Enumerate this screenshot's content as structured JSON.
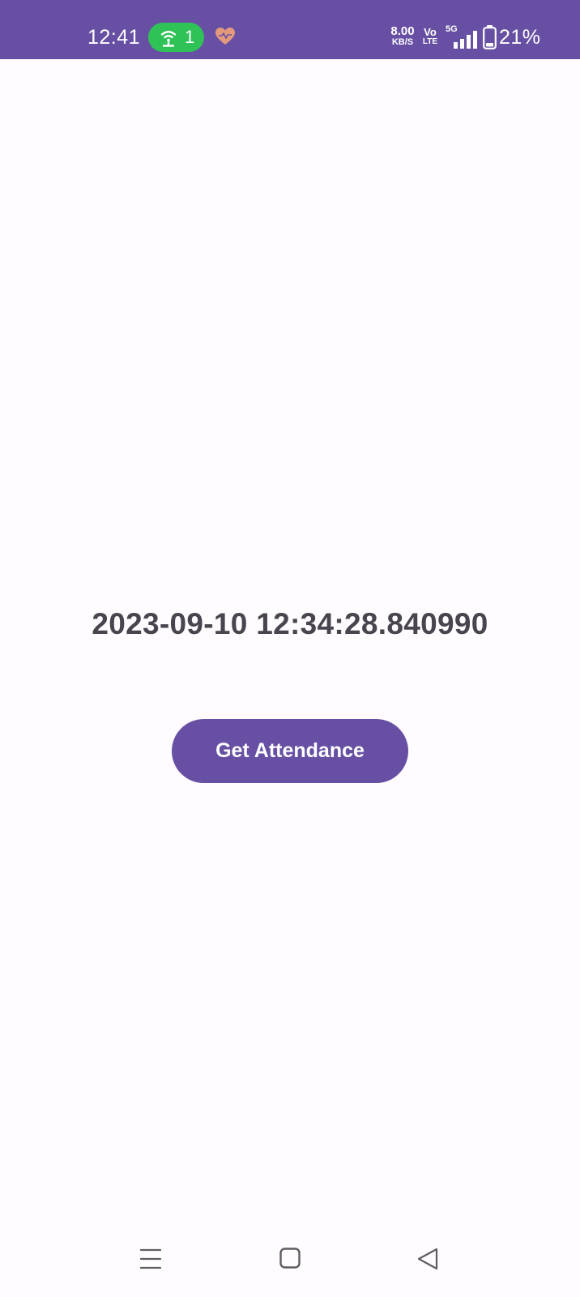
{
  "status_bar": {
    "time": "12:41",
    "hotspot_icon": "hotspot-icon",
    "hotspot_count": "1",
    "heart_icon": "heart-health-icon",
    "net_speed_value": "8.00",
    "net_speed_unit": "KB/S",
    "volte_top": "Vo",
    "volte_bottom": "LTE",
    "network_type": "5G",
    "signal_icon": "signal-bars-icon",
    "battery_icon": "battery-icon",
    "battery_percent": "21%"
  },
  "main": {
    "timestamp": "2023-09-10 12:34:28.840990",
    "get_attendance_label": "Get Attendance"
  },
  "nav_bar": {
    "recents_icon": "menu-lines-icon",
    "home_icon": "square-home-icon",
    "back_icon": "triangle-back-icon"
  },
  "colors": {
    "primary": "#6750a4",
    "background": "#fffbfe",
    "text": "#48454e",
    "hotspot_pill": "#2fc257",
    "heart": "#e39a7c",
    "nav_icon": "#5f5c64"
  }
}
